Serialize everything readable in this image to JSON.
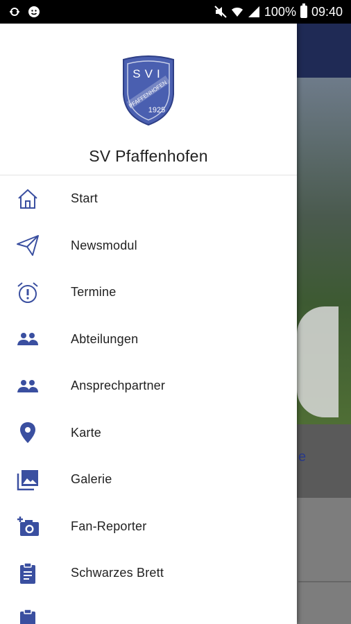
{
  "status_bar": {
    "battery": "100%",
    "time": "09:40"
  },
  "drawer": {
    "club_name": "SV Pfaffenhofen",
    "crest": {
      "top_text": "SV",
      "band_text": "PFAFFENHOFEN",
      "year": "1925"
    },
    "items": [
      {
        "label": "Start",
        "icon": "home-icon"
      },
      {
        "label": "Newsmodul",
        "icon": "send-icon"
      },
      {
        "label": "Termine",
        "icon": "alarm-clock-icon"
      },
      {
        "label": "Abteilungen",
        "icon": "people-icon"
      },
      {
        "label": "Ansprechpartner",
        "icon": "people-icon"
      },
      {
        "label": "Karte",
        "icon": "location-pin-icon"
      },
      {
        "label": "Galerie",
        "icon": "gallery-icon"
      },
      {
        "label": "Fan-Reporter",
        "icon": "add-photo-icon"
      },
      {
        "label": "Schwarzes Brett",
        "icon": "clipboard-icon"
      },
      {
        "label": "",
        "icon": "clipboard-icon"
      }
    ]
  },
  "background": {
    "peek_text": "e"
  },
  "colors": {
    "accent": "#3a4fa0",
    "header_bg": "#1f2a55"
  }
}
